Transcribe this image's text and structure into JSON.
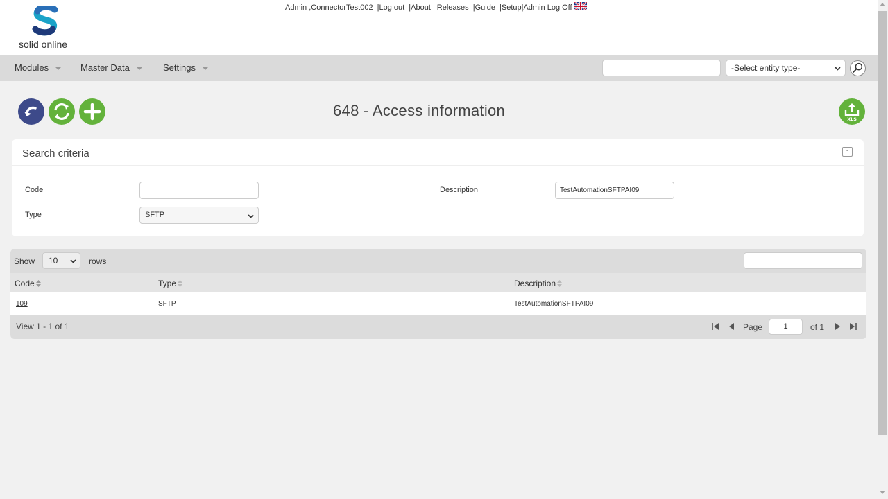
{
  "brand": {
    "name": "solid online"
  },
  "topbar": {
    "user": "Admin ,ConnectorTest002",
    "sep": "|",
    "links": [
      "Log out",
      "About",
      "Releases",
      "Guide",
      "Setup",
      "Admin Log Off"
    ]
  },
  "nav": {
    "menus": [
      "Modules",
      "Master Data",
      "Settings"
    ],
    "search_value": "",
    "entity_select": "-Select entity type-"
  },
  "page": {
    "title": "648 - Access information"
  },
  "search_criteria": {
    "title": "Search criteria",
    "collapse_symbol": "-",
    "code_label": "Code",
    "code_value": "",
    "description_label": "Description",
    "description_value": "TestAutomationSFTPAI09",
    "type_label": "Type",
    "type_value": "SFTP"
  },
  "grid": {
    "show_label": "Show",
    "rows_per_page": "10",
    "rows_label": "rows",
    "filter_value": "",
    "columns": [
      "Code",
      "Type",
      "Description"
    ],
    "rows": [
      {
        "code": "109",
        "type": "SFTP",
        "description": "TestAutomationSFTPAI09"
      }
    ],
    "view_info": "View 1 - 1 of 1",
    "page_label": "Page",
    "current_page": "1",
    "of_label": "of 1"
  },
  "colors": {
    "accent_green": "#63b23b",
    "accent_blue": "#3d4a8a",
    "navbar": "#dadada"
  },
  "icons": {
    "back": "undo-icon",
    "refresh": "refresh-icon",
    "add": "plus-icon",
    "export": "xls-export-icon",
    "search": "magnifier-icon",
    "language": "uk-flag-icon"
  }
}
